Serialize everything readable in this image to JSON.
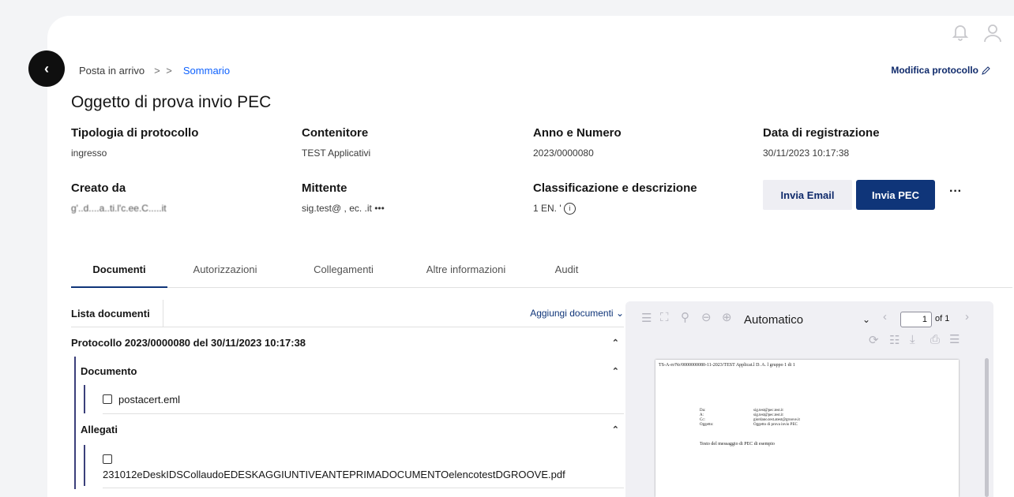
{
  "breadcrumb": {
    "parent": "Posta in arrivo",
    "separator": "> >",
    "current": "Sommario"
  },
  "modify_link": "Modifica protocollo",
  "title": "Oggetto di prova invio PEC",
  "fields": {
    "tipologia": {
      "label": "Tipologia di protocollo",
      "value": "ingresso"
    },
    "contenitore": {
      "label": "Contenitore",
      "value": "TEST Applicativi"
    },
    "anno": {
      "label": "Anno e Numero",
      "value": "2023/0000080"
    },
    "data": {
      "label": "Data di registrazione",
      "value": "30/11/2023 10:17:38"
    },
    "creato": {
      "label": "Creato da",
      "value": "g'..d....a..ti.l'c.ee.C.....it"
    },
    "mittente": {
      "label": "Mittente",
      "value": "sig.test@ , ec.        .it •••"
    },
    "classificazione": {
      "label": "Classificazione e descrizione",
      "value": "1 EN.  '"
    }
  },
  "actions": {
    "invia_email": "Invia Email",
    "invia_pec": "Invia PEC",
    "more": "···"
  },
  "tabs": [
    "Documenti",
    "Autorizzazioni",
    "Collegamenti",
    "Altre informazioni",
    "Audit"
  ],
  "doclist": {
    "header": "Lista documenti",
    "add": "Aggiungi documenti",
    "protocol": "Protocollo 2023/0000080 del 30/11/2023 10:17:38",
    "documento_label": "Documento",
    "documento_file": "postacert.eml",
    "allegati_label": "Allegati",
    "allegato_file": "231012eDeskIDSCollaudoEDESKAGGIUNTIVEANTEPRIMADOCUMENTOelencotestDGROOVE.pdf"
  },
  "viewer": {
    "zoom": "Automatico",
    "page_number": "1",
    "page_of": "of 1",
    "doc_header": "TS-A-rr/Nr/0000000080-11-2023/TEST Applicat.l D. A. l gruppo 1 di 1",
    "rows": [
      {
        "k": "Da:",
        "v": "sig.test@pec.test.it"
      },
      {
        "k": "A:",
        "v": "sig.test@pec.test.it"
      },
      {
        "k": "Cc:",
        "v": "giordano.test.atest@groove.it"
      },
      {
        "k": "Oggetto:",
        "v": "Oggetto di prova invio PEC"
      }
    ],
    "body": "Testo del messaggio di PEC di esempio"
  },
  "colors": {
    "primary": "#0f3579",
    "link": "#0f62fe",
    "accent_line": "#3b3f7a"
  },
  "icons": [
    "chevron-left-icon",
    "bell-icon",
    "user-icon",
    "pencil-icon",
    "info-icon",
    "chevron-down-icon",
    "chevron-up-icon",
    "sidebar-toggle-icon",
    "fullscreen-icon",
    "search-icon",
    "zoom-out-icon",
    "zoom-in-icon",
    "chevron-right-icon",
    "rotate-icon",
    "page-icon",
    "download-icon",
    "print-icon",
    "menu-icon"
  ]
}
